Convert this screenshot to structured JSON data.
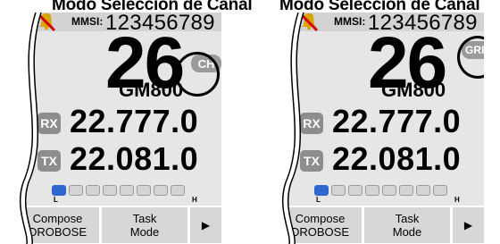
{
  "captions": [
    "Modo Selección de Canal",
    "Modo Selección de Canal"
  ],
  "panels": [
    {
      "mmsi_label": "MMSI:",
      "mmsi_value": "123456789",
      "channel": "26",
      "channel_name": "GM800",
      "mode_badge": "CH",
      "rx_label": "RX",
      "rx_freq": "22.777.0",
      "tx_label": "TX",
      "tx_freq": "22.081.0",
      "meter_low": "L",
      "meter_high": "H",
      "power_level": "1 of 8",
      "softkeys": [
        "Compose",
        "DROBOSE",
        "Task",
        "Mode",
        "▶"
      ]
    },
    {
      "mmsi_label": "MMSI:",
      "mmsi_value": "123456789",
      "channel": "26",
      "channel_name": "GM800",
      "mode_badge": "GRP",
      "rx_label": "RX",
      "rx_freq": "22.777.0",
      "tx_label": "TX",
      "tx_freq": "22.081.0",
      "meter_low": "L",
      "meter_high": "H",
      "power_level": "1 of 8",
      "softkeys": [
        "Compose",
        "DROBOSE",
        "Task",
        "Mode",
        "▶"
      ]
    }
  ],
  "icons": [
    "mute-bell-icon",
    "rx-icon",
    "tx-icon",
    "right-arrow-icon"
  ],
  "colors": {
    "screen_bg": "#e6e6e6",
    "statusbar": "#d3d3d3",
    "badge": "#9a9a9a",
    "meter_on": "#2f67d1"
  }
}
